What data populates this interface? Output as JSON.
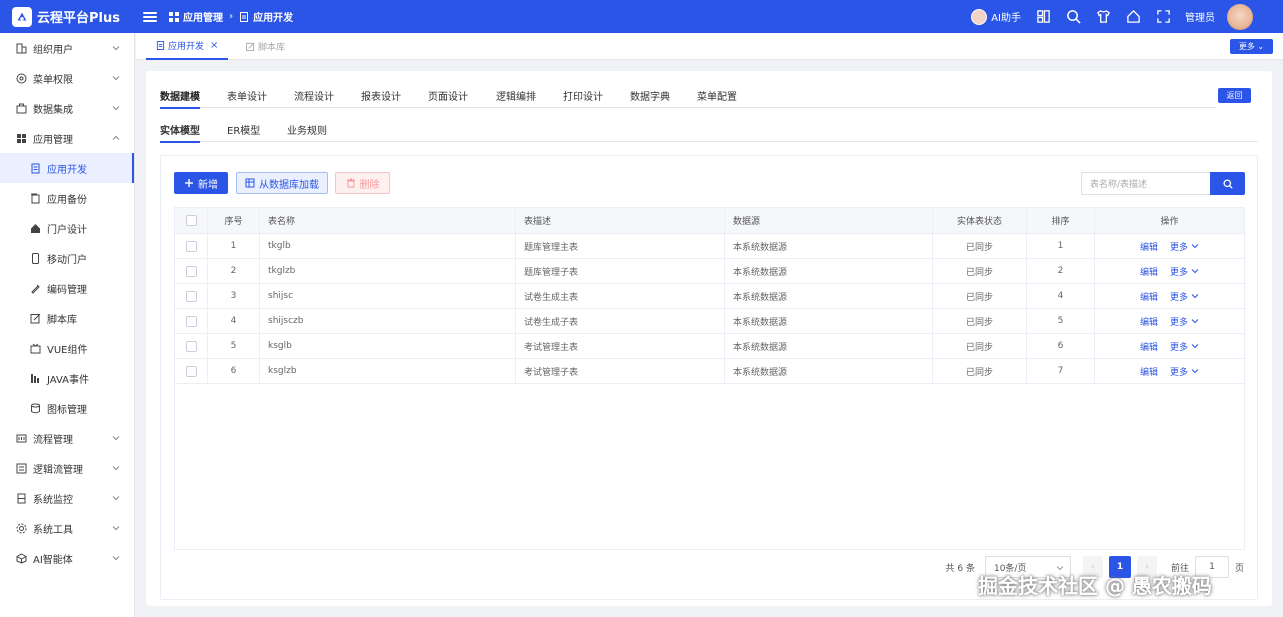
{
  "header": {
    "app_title": "云程平台Plus",
    "breadcrumb": [
      "应用管理",
      "应用开发"
    ],
    "ai_assistant": "AI助手",
    "user": "管理员"
  },
  "sidebar": {
    "items": [
      {
        "label": "组织用户",
        "icon": "org-icon",
        "expandable": true
      },
      {
        "label": "菜单权限",
        "icon": "menu-perm-icon",
        "expandable": true
      },
      {
        "label": "数据集成",
        "icon": "data-integration-icon",
        "expandable": true
      },
      {
        "label": "应用管理",
        "icon": "app-manage-icon",
        "expandable": true,
        "expanded": true
      },
      {
        "label": "应用开发",
        "icon": "doc-icon",
        "sub": true,
        "active": true
      },
      {
        "label": "应用备份",
        "icon": "backup-icon",
        "sub": true
      },
      {
        "label": "门户设计",
        "icon": "home-icon",
        "sub": true
      },
      {
        "label": "移动门户",
        "icon": "mobile-icon",
        "sub": true
      },
      {
        "label": "编码管理",
        "icon": "code-icon",
        "sub": true
      },
      {
        "label": "脚本库",
        "icon": "script-icon",
        "sub": true
      },
      {
        "label": "VUE组件",
        "icon": "vue-icon",
        "sub": true
      },
      {
        "label": "JAVA事件",
        "icon": "java-icon",
        "sub": true
      },
      {
        "label": "图标管理",
        "icon": "icon-manage-icon",
        "sub": true
      },
      {
        "label": "流程管理",
        "icon": "flow-icon",
        "expandable": true
      },
      {
        "label": "逻辑流管理",
        "icon": "logic-icon",
        "expandable": true
      },
      {
        "label": "系统监控",
        "icon": "monitor-icon",
        "expandable": true
      },
      {
        "label": "系统工具",
        "icon": "tools-icon",
        "expandable": true
      },
      {
        "label": "AI智能体",
        "icon": "ai-agent-icon",
        "expandable": true
      }
    ]
  },
  "tabs": {
    "open": [
      "应用开发",
      "脚本库"
    ],
    "more": "更多"
  },
  "main_tabs": [
    "数据建模",
    "表单设计",
    "流程设计",
    "报表设计",
    "页面设计",
    "逻辑编排",
    "打印设计",
    "数据字典",
    "菜单配置"
  ],
  "back_label": "返回",
  "sub_tabs": [
    "实体模型",
    "ER模型",
    "业务规则"
  ],
  "toolbar": {
    "add": "新增",
    "load": "从数据库加载",
    "delete": "删除",
    "search_placeholder": "表名称/表描述"
  },
  "table": {
    "headers": [
      "序号",
      "表名称",
      "表描述",
      "数据源",
      "实体表状态",
      "排序",
      "操作"
    ],
    "rows": [
      {
        "no": "1",
        "name": "tkglb",
        "desc": "题库管理主表",
        "source": "本系统数据源",
        "status": "已同步",
        "order": "1"
      },
      {
        "no": "2",
        "name": "tkglzb",
        "desc": "题库管理子表",
        "source": "本系统数据源",
        "status": "已同步",
        "order": "2"
      },
      {
        "no": "3",
        "name": "shijsc",
        "desc": "试卷生成主表",
        "source": "本系统数据源",
        "status": "已同步",
        "order": "4"
      },
      {
        "no": "4",
        "name": "shijsczb",
        "desc": "试卷生成子表",
        "source": "本系统数据源",
        "status": "已同步",
        "order": "5"
      },
      {
        "no": "5",
        "name": "ksglb",
        "desc": "考试管理主表",
        "source": "本系统数据源",
        "status": "已同步",
        "order": "6"
      },
      {
        "no": "6",
        "name": "ksglzb",
        "desc": "考试管理子表",
        "source": "本系统数据源",
        "status": "已同步",
        "order": "7"
      }
    ],
    "edit": "编辑",
    "more": "更多"
  },
  "pager": {
    "total": "共 6 条",
    "page_size": "10条/页",
    "current": "1",
    "goto_label": "前往",
    "goto_value": "1",
    "page_unit": "页"
  },
  "watermark": "掘金技术社区 @ 愚农搬码"
}
